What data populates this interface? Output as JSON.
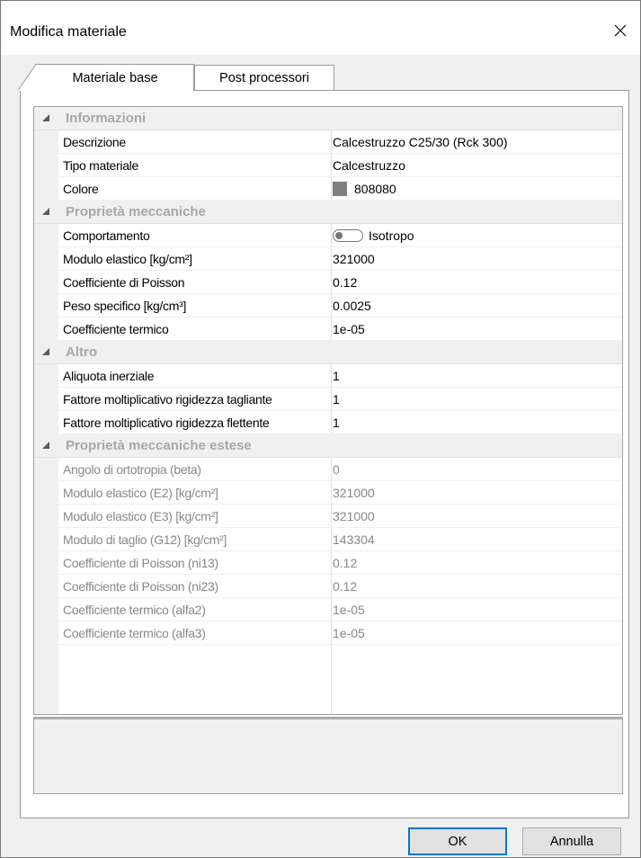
{
  "window": {
    "title": "Modifica materiale"
  },
  "tabs": [
    {
      "label": "Materiale base",
      "active": true
    },
    {
      "label": "Post processori",
      "active": false
    }
  ],
  "categories": [
    {
      "label": "Informazioni",
      "properties": [
        {
          "name": "Descrizione",
          "value": "Calcestruzzo C25/30 (Rck 300)"
        },
        {
          "name": "Tipo materiale",
          "value": "Calcestruzzo"
        },
        {
          "name": "Colore",
          "value": "808080",
          "color": "#808080"
        }
      ]
    },
    {
      "label": "Proprietà meccaniche",
      "properties": [
        {
          "name": "Comportamento",
          "value": "Isotropo"
        },
        {
          "name": "Modulo elastico [kg/cm²]",
          "value": "321000"
        },
        {
          "name": "Coefficiente di Poisson",
          "value": "0.12"
        },
        {
          "name": "Peso specifico [kg/cm³]",
          "value": "0.0025"
        },
        {
          "name": "Coefficiente termico",
          "value": "1e-05"
        }
      ]
    },
    {
      "label": "Altro",
      "properties": [
        {
          "name": "Aliquota inerziale",
          "value": "1"
        },
        {
          "name": "Fattore moltiplicativo rigidezza tagliante",
          "value": "1"
        },
        {
          "name": "Fattore moltiplicativo rigidezza flettente",
          "value": "1"
        }
      ]
    },
    {
      "label": "Proprietà meccaniche estese",
      "properties": [
        {
          "name": "Angolo di ortotropia (beta)",
          "value": "0"
        },
        {
          "name": "Modulo elastico (E2) [kg/cm²]",
          "value": "321000"
        },
        {
          "name": "Modulo elastico (E3) [kg/cm²]",
          "value": "321000"
        },
        {
          "name": "Modulo di taglio (G12) [kg/cm²]",
          "value": "143304"
        },
        {
          "name": "Coefficiente di Poisson (ni13)",
          "value": "0.12"
        },
        {
          "name": "Coefficiente di Poisson (ni23)",
          "value": "0.12"
        },
        {
          "name": "Coefficiente termico (alfa2)",
          "value": "1e-05"
        },
        {
          "name": "Coefficiente termico (alfa3)",
          "value": "1e-05"
        }
      ]
    }
  ],
  "buttons": {
    "ok": "OK",
    "cancel": "Annulla"
  },
  "icons": {
    "close": "close-icon",
    "collapse": "collapse-triangle-icon"
  },
  "colors": {
    "accent": "#0078d7",
    "disabled_text": "#888888",
    "category_bg": "#f0f0f0"
  }
}
